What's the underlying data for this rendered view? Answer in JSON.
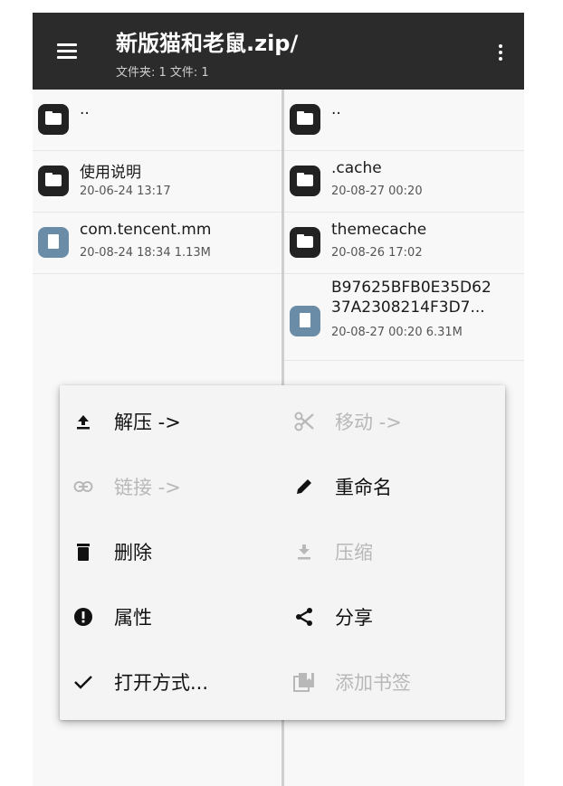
{
  "header": {
    "title": "新版猫和老鼠.zip/",
    "subtitle": "文件夹: 1  文件: 1"
  },
  "left_pane": {
    "items": [
      {
        "name": "..",
        "meta": "",
        "type": "folder"
      },
      {
        "name": "使用说明",
        "meta": "20-06-24 13:17",
        "type": "folder"
      },
      {
        "name": "com.tencent.mm",
        "meta": "20-08-24 18:34  1.13M",
        "type": "file"
      }
    ]
  },
  "right_pane": {
    "items": [
      {
        "name": "..",
        "meta": "",
        "type": "folder"
      },
      {
        "name": ".cache",
        "meta": "20-08-27 00:20",
        "type": "folder"
      },
      {
        "name": "themecache",
        "meta": "20-08-26 17:02",
        "type": "folder"
      },
      {
        "name_line1": "B97625BFB0E35D62",
        "name_line2": "37A2308214F3D7...",
        "meta": "20-08-27 00:20  6.31M",
        "type": "file"
      }
    ]
  },
  "context_menu": {
    "items": [
      {
        "label": "解压 ->",
        "icon": "upload-icon",
        "enabled": true
      },
      {
        "label": "移动 ->",
        "icon": "scissors-icon",
        "enabled": false
      },
      {
        "label": "链接 ->",
        "icon": "link-icon",
        "enabled": false
      },
      {
        "label": "重命名",
        "icon": "pencil-icon",
        "enabled": true
      },
      {
        "label": "删除",
        "icon": "trash-icon",
        "enabled": true
      },
      {
        "label": "压缩",
        "icon": "download-icon",
        "enabled": false
      },
      {
        "label": "属性",
        "icon": "info-icon",
        "enabled": true
      },
      {
        "label": "分享",
        "icon": "share-icon",
        "enabled": true
      },
      {
        "label": "打开方式...",
        "icon": "check-icon",
        "enabled": true
      },
      {
        "label": "添加书签",
        "icon": "bookmark-icon",
        "enabled": false
      }
    ]
  },
  "colors": {
    "appbar": "#2b2b2b",
    "folder_icon": "#222222",
    "file_icon": "#6b8ca6",
    "disabled_text": "#b8b8b8"
  }
}
